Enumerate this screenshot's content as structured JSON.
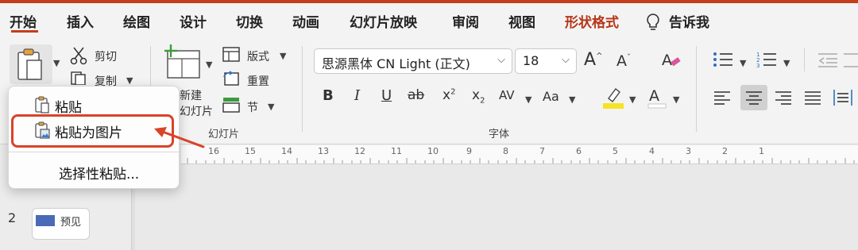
{
  "tabs": [
    {
      "label": "开始"
    },
    {
      "label": "插入"
    },
    {
      "label": "绘图"
    },
    {
      "label": "设计"
    },
    {
      "label": "切换"
    },
    {
      "label": "动画"
    },
    {
      "label": "幻灯片放映"
    },
    {
      "label": "审阅"
    },
    {
      "label": "视图"
    },
    {
      "label": "形状格式"
    },
    {
      "label": "告诉我"
    }
  ],
  "clipboard": {
    "cut": "剪切",
    "copy": "复制"
  },
  "slides": {
    "new_line1": "新建",
    "new_line2": "幻灯片",
    "layout": "版式",
    "reset": "重置",
    "section": "节",
    "group_label": "幻灯片"
  },
  "font": {
    "name": "思源黑体 CN Light (正文)",
    "size": "18",
    "group_label": "字体",
    "case_label": "Aa",
    "char_spacing": "AV"
  },
  "ruler": {
    "numbers": [
      "16",
      "15",
      "14",
      "13",
      "12",
      "11",
      "10",
      "9",
      "8",
      "7",
      "6",
      "5",
      "4",
      "3",
      "2",
      "1"
    ]
  },
  "menu": {
    "items": [
      {
        "label": "粘贴"
      },
      {
        "label": "粘贴为图片"
      },
      {
        "label": "选择性粘贴..."
      }
    ]
  },
  "thumbnails": [
    {
      "number": "2",
      "label": "预见"
    }
  ],
  "colors": {
    "accent": "#c43e1c",
    "highlight_border": "#d9432a",
    "arrow": "#d9432a",
    "highlighter": "#f5e324"
  },
  "icons": [
    "paste-icon",
    "scissors-icon",
    "copy-icon",
    "bulb-icon",
    "new-slide-icon",
    "layout-icon",
    "reset-icon",
    "section-icon",
    "bullets-icon",
    "numbering-icon",
    "align-center-icon"
  ]
}
